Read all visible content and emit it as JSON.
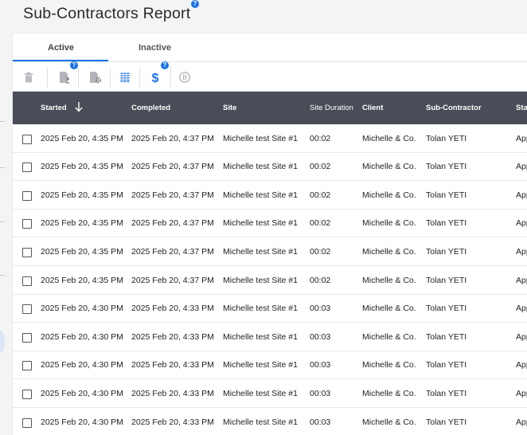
{
  "page": {
    "title": "Sub-Contractors Report"
  },
  "tabs": [
    {
      "label": "Active",
      "active": true
    },
    {
      "label": "Inactive",
      "active": false
    }
  ],
  "toolbar": {
    "icons": [
      "trash-icon",
      "document-person-icon",
      "document-gear-icon",
      "columns-list-icon",
      "dollar-icon",
      "no-charge-icon"
    ],
    "accent": "#1a73e8"
  },
  "table": {
    "header_bg": "#4a4d57",
    "columns": [
      "Started",
      "Completed",
      "Site",
      "Site Duration",
      "Client",
      "Sub-Contractor",
      "Sta"
    ],
    "rows": [
      [
        "2025 Feb 20, 4:35 PM",
        "2025 Feb 20, 4:37 PM",
        "Michelle test Site #1",
        "00:02",
        "Michelle & Co.",
        "Tolan YETI",
        "App"
      ],
      [
        "2025 Feb 20, 4:35 PM",
        "2025 Feb 20, 4:37 PM",
        "Michelle test Site #1",
        "00:02",
        "Michelle & Co.",
        "Tolan YETI",
        "App"
      ],
      [
        "2025 Feb 20, 4:35 PM",
        "2025 Feb 20, 4:37 PM",
        "Michelle test Site #1",
        "00:02",
        "Michelle & Co.",
        "Tolan YETI",
        "App"
      ],
      [
        "2025 Feb 20, 4:35 PM",
        "2025 Feb 20, 4:37 PM",
        "Michelle test Site #1",
        "00:02",
        "Michelle & Co.",
        "Tolan YETI",
        "App"
      ],
      [
        "2025 Feb 20, 4:35 PM",
        "2025 Feb 20, 4:37 PM",
        "Michelle test Site #1",
        "00:02",
        "Michelle & Co.",
        "Tolan YETI",
        "App"
      ],
      [
        "2025 Feb 20, 4:35 PM",
        "2025 Feb 20, 4:37 PM",
        "Michelle test Site #1",
        "00:02",
        "Michelle & Co.",
        "Tolan YETI",
        "App"
      ],
      [
        "2025 Feb 20, 4:30 PM",
        "2025 Feb 20, 4:33 PM",
        "Michelle test Site #1",
        "00:03",
        "Michelle & Co.",
        "Tolan YETI",
        "App"
      ],
      [
        "2025 Feb 20, 4:30 PM",
        "2025 Feb 20, 4:33 PM",
        "Michelle test Site #1",
        "00:03",
        "Michelle & Co.",
        "Tolan YETI",
        "App"
      ],
      [
        "2025 Feb 20, 4:30 PM",
        "2025 Feb 20, 4:33 PM",
        "Michelle test Site #1",
        "00:03",
        "Michelle & Co.",
        "Tolan YETI",
        "App"
      ],
      [
        "2025 Feb 20, 4:30 PM",
        "2025 Feb 20, 4:33 PM",
        "Michelle test Site #1",
        "00:03",
        "Michelle & Co.",
        "Tolan YETI",
        "App"
      ],
      [
        "2025 Feb 20, 4:30 PM",
        "2025 Feb 20, 4:33 PM",
        "Michelle test Site #1",
        "00:03",
        "Michelle & Co.",
        "Tolan YETI",
        "App"
      ]
    ]
  }
}
